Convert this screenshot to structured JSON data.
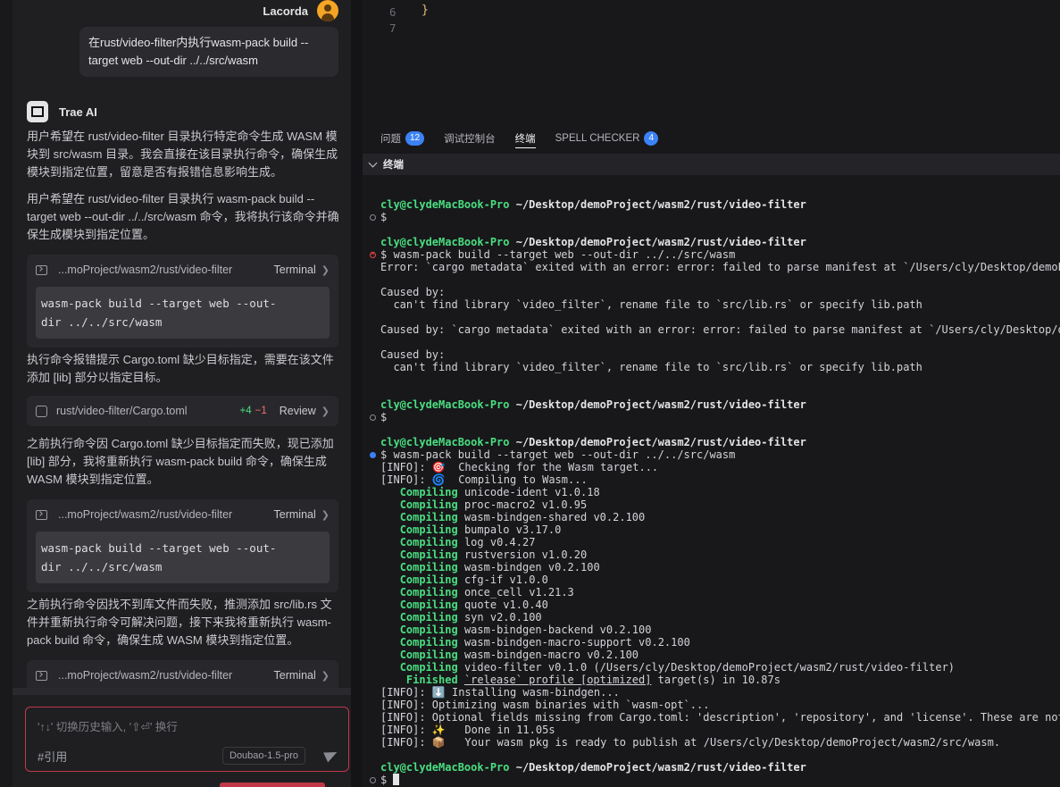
{
  "chat": {
    "user_name": "Lacorda",
    "user_message": "在rust/video-filter内执行wasm-pack build --target web --out-dir ../../src/wasm",
    "assistant_name": "Trae AI",
    "paragraphs": [
      "用户希望在 rust/video-filter 目录执行特定命令生成 WASM 模块到 src/wasm 目录。我会直接在该目录执行命令，确保生成模块到指定位置，留意是否有报错信息影响生成。",
      "用户希望在 rust/video-filter 目录执行 wasm-pack build --target web --out-dir ../../src/wasm 命令，我将执行该命令并确保生成模块到指定位置。",
      "执行命令报错提示 Cargo.toml 缺少目标指定，需要在该文件添加 [lib] 部分以指定目标。",
      "之前执行命令因 Cargo.toml 缺少目标指定而失败，现已添加 [lib] 部分，我将重新执行 wasm-pack build 命令，确保生成 WASM 模块到指定位置。",
      "之前执行命令因找不到库文件而失败，推测添加 src/lib.rs 文件并重新执行命令可解决问题，接下来我将重新执行 wasm-pack build 命令，确保生成 WASM 模块到指定位置。"
    ],
    "terminal_cards": [
      {
        "path": "...moProject/wasm2/rust/video-filter",
        "kind": "Terminal",
        "command": "wasm-pack build --target web --out-dir ../../src/wasm"
      },
      {
        "path": "...moProject/wasm2/rust/video-filter",
        "kind": "Terminal",
        "command": "wasm-pack build --target web --out-dir ../../src/wasm"
      },
      {
        "path": "...moProject/wasm2/rust/video-filter",
        "kind": "Terminal"
      }
    ],
    "command_lines": [
      "wasm-pack build --target web --out-",
      "dir ../../src/wasm"
    ],
    "edit_card": {
      "file": "rust/video-filter/Cargo.toml",
      "added": "+4",
      "removed": "−1",
      "action": "Review"
    },
    "input_placeholder": "'↑↓' 切换历史输入, '⇧⏎' 换行",
    "reference_label": "#引用",
    "model_label": "Doubao-1.5-pro"
  },
  "editor": {
    "line_numbers": [
      "6",
      "7"
    ],
    "line6_text": "}"
  },
  "panel": {
    "tabs": [
      {
        "label": "问题",
        "badge": "12"
      },
      {
        "label": "调试控制台"
      },
      {
        "label": "终端"
      },
      {
        "label": "SPELL CHECKER",
        "badge": "4"
      }
    ],
    "terminal_title": "终端"
  },
  "terminal": {
    "user": "cly@clydeMacBook-Pro",
    "cwd": "~/Desktop/demoProject/wasm2/rust/video-filter",
    "cmd_run": "$ wasm-pack build --target web --out-dir ../../src/wasm",
    "empty_prompt": "$",
    "error1": "Error: `cargo metadata` exited with an error: error: failed to parse manifest at `/Users/cly/Desktop/demoProj",
    "caused_by": "Caused by:",
    "lib_missing": "  can't find library `video_filter`, rename file to `src/lib.rs` or specify lib.path",
    "error2": "Caused by: `cargo metadata` exited with an error: error: failed to parse manifest at `/Users/cly/Desktop/demo",
    "info_check": "[INFO]: 🎯  Checking for the Wasm target...",
    "info_compile": "[INFO]: 🌀  Compiling to Wasm...",
    "compiling_label": "Compiling",
    "crates": [
      "unicode-ident v1.0.18",
      "proc-macro2 v1.0.95",
      "wasm-bindgen-shared v0.2.100",
      "bumpalo v3.17.0",
      "log v0.4.27",
      "rustversion v1.0.20",
      "wasm-bindgen v0.2.100",
      "cfg-if v1.0.0",
      "once_cell v1.21.3",
      "quote v1.0.40",
      "syn v2.0.100",
      "wasm-bindgen-backend v0.2.100",
      "wasm-bindgen-macro-support v0.2.100",
      "wasm-bindgen-macro v0.2.100",
      "video-filter v0.1.0 (/Users/cly/Desktop/demoProject/wasm2/rust/video-filter)"
    ],
    "finished_label": "Finished",
    "finished_profile": "`release` profile [optimized]",
    "finished_rest": " target(s) in 10.87s",
    "info_install": "[INFO]: ⬇️ Installing wasm-bindgen...",
    "info_optimize": "[INFO]: Optimizing wasm binaries with `wasm-opt`...",
    "info_optional": "[INFO]: Optional fields missing from Cargo.toml: 'description', 'repository', and 'license'. These are not ne",
    "info_done": "[INFO]: ✨   Done in 11.05s",
    "info_ready": "[INFO]: 📦   Your wasm pkg is ready to publish at /Users/cly/Desktop/demoProject/wasm2/src/wasm."
  },
  "colors": {
    "accent_blue": "#3b82f6",
    "prompt_green": "#4ade80",
    "error_red": "#ef4444",
    "input_border": "#c0384a"
  }
}
